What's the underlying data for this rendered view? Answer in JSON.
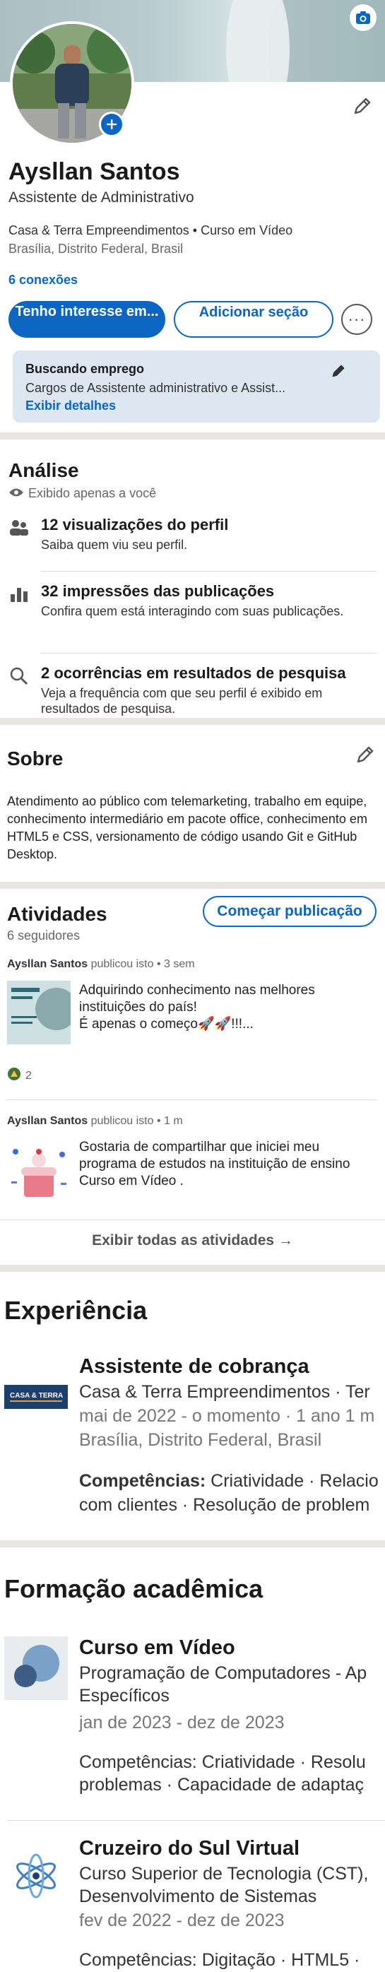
{
  "profile": {
    "name": "Aysllan Santos",
    "headline": "Assistente de Administrativo",
    "company_line": "Casa & Terra Empreendimentos • Curso em Vídeo",
    "location": "Brasília, Distrito Federal, Brasil",
    "connections": "6 conexões",
    "btn_interest": "Tenho interesse em...",
    "btn_add_section": "Adicionar seção",
    "btn_more": "···"
  },
  "open_to_work": {
    "title": "Buscando emprego",
    "description": "Cargos de Assistente administrativo e Assist...",
    "link": "Exibir detalhes"
  },
  "analytics": {
    "title": "Análise",
    "privacy": "Exibido apenas a você",
    "items": [
      {
        "icon": "people-icon",
        "head": "12 visualizações do perfil",
        "sub": "Saiba quem viu seu perfil."
      },
      {
        "icon": "bar-chart-icon",
        "head": "32 impressões das publicações",
        "sub": "Confira quem está interagindo com suas publicações."
      },
      {
        "icon": "search-icon",
        "head": "2 ocorrências em resultados de pesquisa",
        "sub": "Veja a frequência com que seu perfil é exibido em resultados de pesquisa."
      }
    ]
  },
  "about": {
    "title": "Sobre",
    "text": "Atendimento ao público com telemarketing, trabalho em equipe, conhecimento intermediário em pacote office, conhecimento em HTML5 e CSS, versionamento de código usando Git e GitHub Desktop."
  },
  "activity": {
    "title": "Atividades",
    "followers": "6 seguidores",
    "start_post": "Começar publicação",
    "posts": [
      {
        "author": "Aysllan Santos",
        "meta": "publicou isto • 3 sem",
        "text": "Adquirindo conhecimento nas melhores instituições do país!\nÉ apenas o começo🚀🚀!!!...",
        "reactions": "2"
      },
      {
        "author": "Aysllan Santos",
        "meta": "publicou isto • 1 m",
        "text": "Gostaria de compartilhar que iniciei meu programa de estudos na instituição de ensino Curso em Vídeo ."
      }
    ],
    "show_all": "Exibir todas as atividades →"
  },
  "experience": {
    "title": "Experiência",
    "entries": [
      {
        "role": "Assistente de cobrança",
        "company": "Casa & Terra Empreendimentos · Ter",
        "dates": "mai de 2022 - o momento · 1 ano 1 m",
        "location": "Brasília, Distrito Federal, Brasil",
        "skills_label": "Competências:",
        "skills": " Criatividade · Relacio",
        "skills_2": "com clientes · Resolução de problem"
      }
    ]
  },
  "education": {
    "title": "Formação acadêmica",
    "entries": [
      {
        "school": "Curso em Vídeo",
        "degree": "Programação de Computadores - Ap",
        "degree_2": "Específicos",
        "dates": "jan de 2023 - dez de 2023",
        "skills": "Competências: Criatividade · Resolu",
        "skills_2": "problemas · Capacidade de adaptaç"
      },
      {
        "school": "Cruzeiro do Sul Virtual",
        "degree": "Curso Superior de Tecnologia (CST),",
        "degree_2": "Desenvolvimento de Sistemas",
        "dates": "fev de 2022 - dez de 2023",
        "skills": "Competências: Digitação · HTML5 ·"
      }
    ]
  },
  "colors": {
    "accent": "#0a66c2",
    "separator": "#e9e5df",
    "otw_bg": "#dde7f1"
  }
}
